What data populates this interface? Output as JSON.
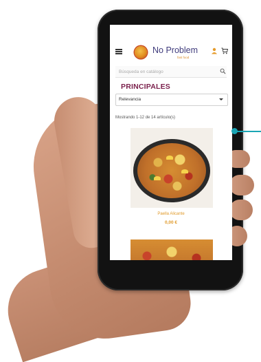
{
  "app": {
    "brand_name": "No Problem",
    "brand_tagline": "fast food"
  },
  "search": {
    "placeholder": "Búsqueda en catálogo"
  },
  "category": {
    "title": "PRINCIPALES"
  },
  "sort": {
    "selected": "Relevancia"
  },
  "listing": {
    "count_text": "Mostrando 1-12 de 14 artículo(s)"
  },
  "products": [
    {
      "name": "Paella Alicante",
      "price": "0,00 €"
    }
  ],
  "colors": {
    "section_title": "#7a1f4b",
    "brand_text": "#3f3b7c",
    "price_accent": "#e09a2a",
    "callout": "#1aa5b4"
  },
  "icons": [
    "menu-icon",
    "logo",
    "user-icon",
    "cart-icon",
    "search-icon",
    "chevron-down-icon"
  ]
}
